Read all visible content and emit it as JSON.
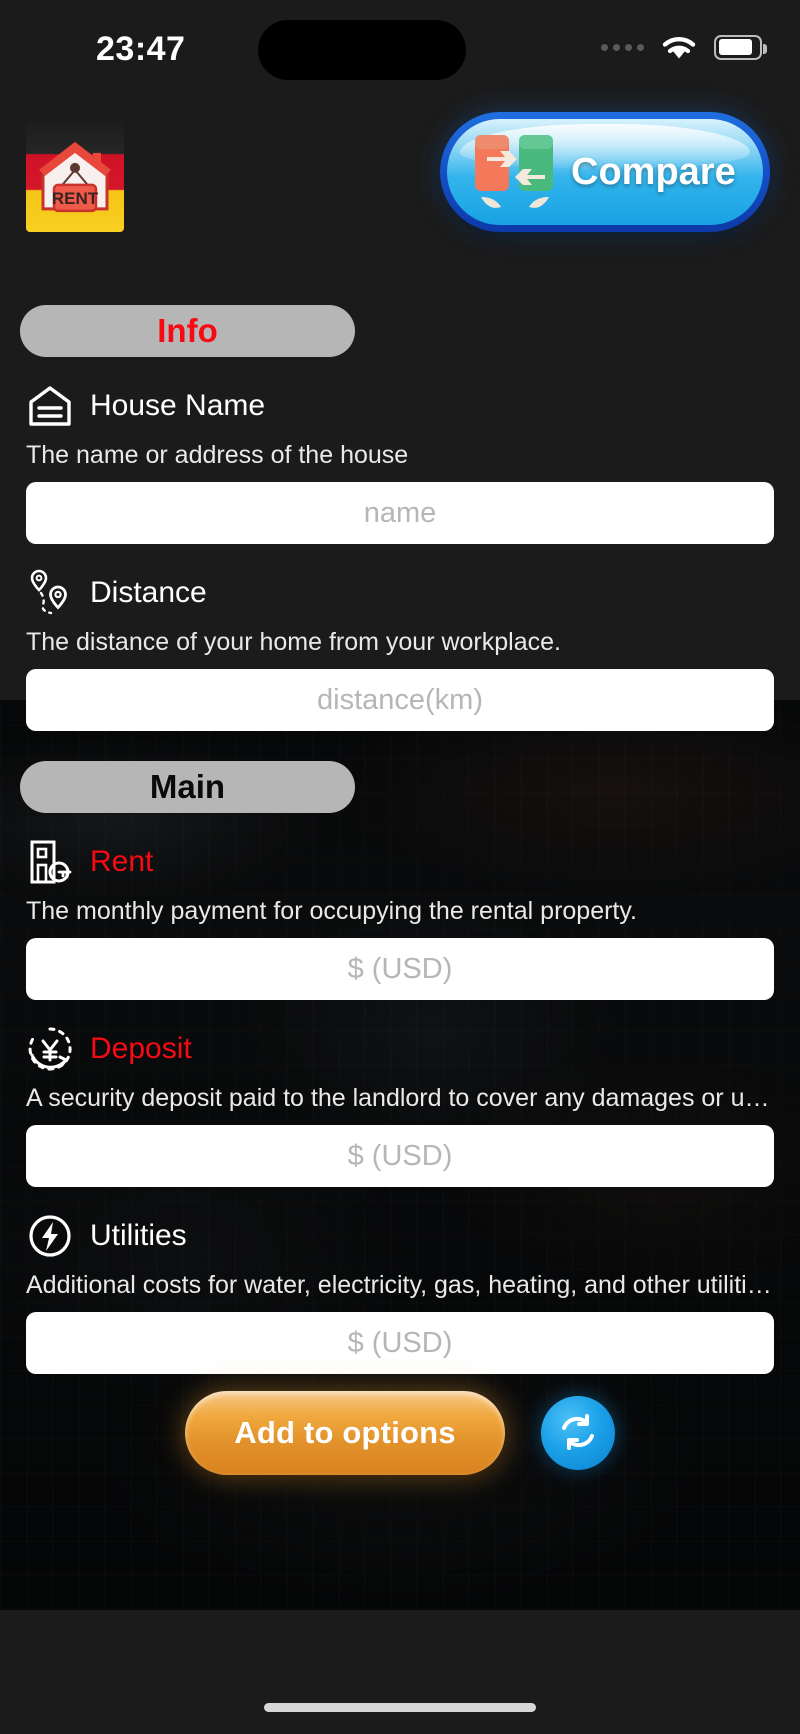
{
  "status_bar": {
    "time": "23:47",
    "signal_icon": "signal-dots-icon",
    "wifi_icon": "wifi-icon",
    "battery_icon": "battery-icon"
  },
  "header": {
    "logo": {
      "icon": "rent-house-logo",
      "badge_text": "RENT"
    },
    "compare_button": {
      "label": "Compare",
      "icon": "compare-arrows-icon",
      "accent": "#17a2e3"
    }
  },
  "sections": [
    {
      "pill_label": "Info",
      "pill_color": "#f80a12",
      "fields": [
        {
          "icon": "house-outline-icon",
          "title": "House Name",
          "title_color": "#ffffff",
          "description": "The name or address of the house",
          "placeholder": "name",
          "value": ""
        },
        {
          "icon": "route-pins-icon",
          "title": "Distance",
          "title_color": "#ffffff",
          "description": "The distance of your home from your workplace.",
          "placeholder": "distance(km)",
          "value": ""
        }
      ]
    },
    {
      "pill_label": "Main",
      "pill_color": "#0a0a0a",
      "fields": [
        {
          "icon": "building-key-icon",
          "title": "Rent",
          "title_color": "#f80a12",
          "description": "The monthly payment for occupying the rental property.",
          "placeholder": "$ (USD)",
          "value": ""
        },
        {
          "icon": "currency-refund-icon",
          "title": "Deposit",
          "title_color": "#f80a12",
          "description": "A security deposit paid to the landlord to cover any damages or unpa…",
          "placeholder": "$ (USD)",
          "value": ""
        },
        {
          "icon": "lightning-bolt-icon",
          "title": "Utilities",
          "title_color": "#ffffff",
          "description": "Additional costs for water, electricity, gas, heating, and other utilities.",
          "placeholder": "$ (USD)",
          "value": ""
        }
      ]
    }
  ],
  "footer": {
    "add_button_label": "Add to options",
    "add_button_color": "#e3922b",
    "refresh_button_icon": "refresh-sync-icon",
    "refresh_button_color": "#1ca2e8"
  }
}
